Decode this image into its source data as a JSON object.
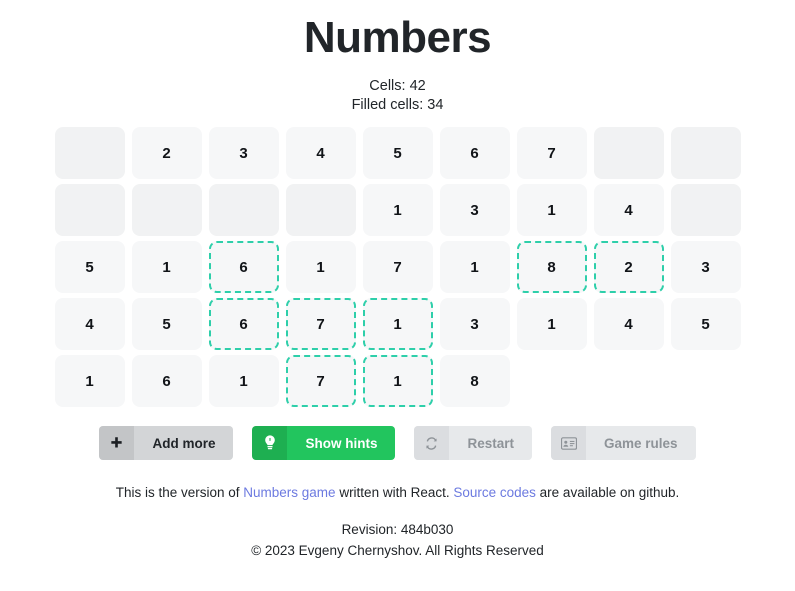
{
  "header": {
    "title": "Numbers",
    "cells_label": "Cells: 42",
    "filled_label": "Filled cells: 34"
  },
  "colors": {
    "hint_border": "#2ecfaa",
    "primary_green": "#22c55e",
    "cell_bg": "#f6f7f8",
    "link": "#6c7ae0"
  },
  "board": {
    "columns": 9,
    "rows": [
      {
        "cells": [
          {
            "value": "",
            "empty": true,
            "hint": false
          },
          {
            "value": "2",
            "empty": false,
            "hint": false
          },
          {
            "value": "3",
            "empty": false,
            "hint": false
          },
          {
            "value": "4",
            "empty": false,
            "hint": false
          },
          {
            "value": "5",
            "empty": false,
            "hint": false
          },
          {
            "value": "6",
            "empty": false,
            "hint": false
          },
          {
            "value": "7",
            "empty": false,
            "hint": false
          },
          {
            "value": "",
            "empty": true,
            "hint": false
          },
          {
            "value": "",
            "empty": true,
            "hint": false
          }
        ]
      },
      {
        "cells": [
          {
            "value": "",
            "empty": true,
            "hint": false
          },
          {
            "value": "",
            "empty": true,
            "hint": false
          },
          {
            "value": "",
            "empty": true,
            "hint": false
          },
          {
            "value": "",
            "empty": true,
            "hint": false
          },
          {
            "value": "1",
            "empty": false,
            "hint": false
          },
          {
            "value": "3",
            "empty": false,
            "hint": false
          },
          {
            "value": "1",
            "empty": false,
            "hint": false
          },
          {
            "value": "4",
            "empty": false,
            "hint": false
          },
          {
            "value": "",
            "empty": true,
            "hint": false
          }
        ]
      },
      {
        "cells": [
          {
            "value": "5",
            "empty": false,
            "hint": false
          },
          {
            "value": "1",
            "empty": false,
            "hint": false
          },
          {
            "value": "6",
            "empty": false,
            "hint": true
          },
          {
            "value": "1",
            "empty": false,
            "hint": false
          },
          {
            "value": "7",
            "empty": false,
            "hint": false
          },
          {
            "value": "1",
            "empty": false,
            "hint": false
          },
          {
            "value": "8",
            "empty": false,
            "hint": true
          },
          {
            "value": "2",
            "empty": false,
            "hint": true
          },
          {
            "value": "3",
            "empty": false,
            "hint": false
          }
        ]
      },
      {
        "cells": [
          {
            "value": "4",
            "empty": false,
            "hint": false
          },
          {
            "value": "5",
            "empty": false,
            "hint": false
          },
          {
            "value": "6",
            "empty": false,
            "hint": true
          },
          {
            "value": "7",
            "empty": false,
            "hint": true
          },
          {
            "value": "1",
            "empty": false,
            "hint": true
          },
          {
            "value": "3",
            "empty": false,
            "hint": false
          },
          {
            "value": "1",
            "empty": false,
            "hint": false
          },
          {
            "value": "4",
            "empty": false,
            "hint": false
          },
          {
            "value": "5",
            "empty": false,
            "hint": false
          }
        ]
      },
      {
        "cells": [
          {
            "value": "1",
            "empty": false,
            "hint": false
          },
          {
            "value": "6",
            "empty": false,
            "hint": false
          },
          {
            "value": "1",
            "empty": false,
            "hint": false
          },
          {
            "value": "7",
            "empty": false,
            "hint": true
          },
          {
            "value": "1",
            "empty": false,
            "hint": true
          },
          {
            "value": "8",
            "empty": false,
            "hint": false
          }
        ]
      }
    ]
  },
  "buttons": [
    {
      "id": "add-more",
      "label": "Add more",
      "icon": "plus-icon",
      "style": "grey",
      "disabled": false
    },
    {
      "id": "show-hints",
      "label": "Show hints",
      "icon": "lightbulb-icon",
      "style": "green",
      "disabled": false
    },
    {
      "id": "restart",
      "label": "Restart",
      "icon": "refresh-icon",
      "style": "disabled",
      "disabled": true
    },
    {
      "id": "game-rules",
      "label": "Game rules",
      "icon": "address-card-icon",
      "style": "disabled",
      "disabled": true
    }
  ],
  "footer": {
    "text_before": "This is the version of ",
    "link1": "Numbers game",
    "text_middle": " written with React. ",
    "link2": "Source codes",
    "text_after": " are available on github.",
    "revision": "Revision: 484b030",
    "copyright": "© 2023 Evgeny Chernyshov. All Rights Reserved"
  }
}
